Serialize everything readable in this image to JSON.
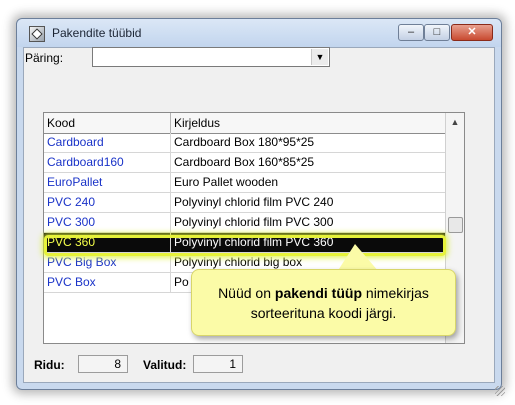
{
  "window": {
    "title": "Pakendite tüübid",
    "minimize_glyph": "–",
    "maximize_glyph": "□",
    "close_glyph": "✕"
  },
  "query": {
    "label": "Päring:",
    "value": "",
    "dropdown_glyph": "▼"
  },
  "grid": {
    "columns": [
      "Kood",
      "Kirjeldus"
    ],
    "rows": [
      {
        "code": "Cardboard",
        "desc": "Cardboard Box 180*95*25"
      },
      {
        "code": "Cardboard160",
        "desc": "Cardboard Box 160*85*25"
      },
      {
        "code": "EuroPallet",
        "desc": "Euro Pallet wooden"
      },
      {
        "code": "PVC 240",
        "desc": "Polyvinyl chlorid film PVC 240"
      },
      {
        "code": "PVC 300",
        "desc": "Polyvinyl chlorid film PVC 300"
      },
      {
        "code": "PVC 360",
        "desc": "Polyvinyl chlorid film PVC 360"
      },
      {
        "code": "PVC Big Box",
        "desc": "Polyvinyl chlorid big box"
      },
      {
        "code": "PVC Box",
        "desc": "Po"
      }
    ],
    "selected_index": 5,
    "scroll_up_glyph": "▲"
  },
  "callout": {
    "before": "Nüüd on ",
    "bold": "pakendi tüüp",
    "after": " nimekirjas",
    "line2": "sorteerituna koodi järgi."
  },
  "status": {
    "rows_label": "Ridu:",
    "rows_value": "8",
    "selected_label": "Valitud:",
    "selected_value": "1"
  },
  "colors": {
    "code_text": "#1a33c8",
    "selected_bg": "#0a0a0a",
    "highlight": "#e6f23a",
    "callout_bg": "#fbfba7"
  }
}
